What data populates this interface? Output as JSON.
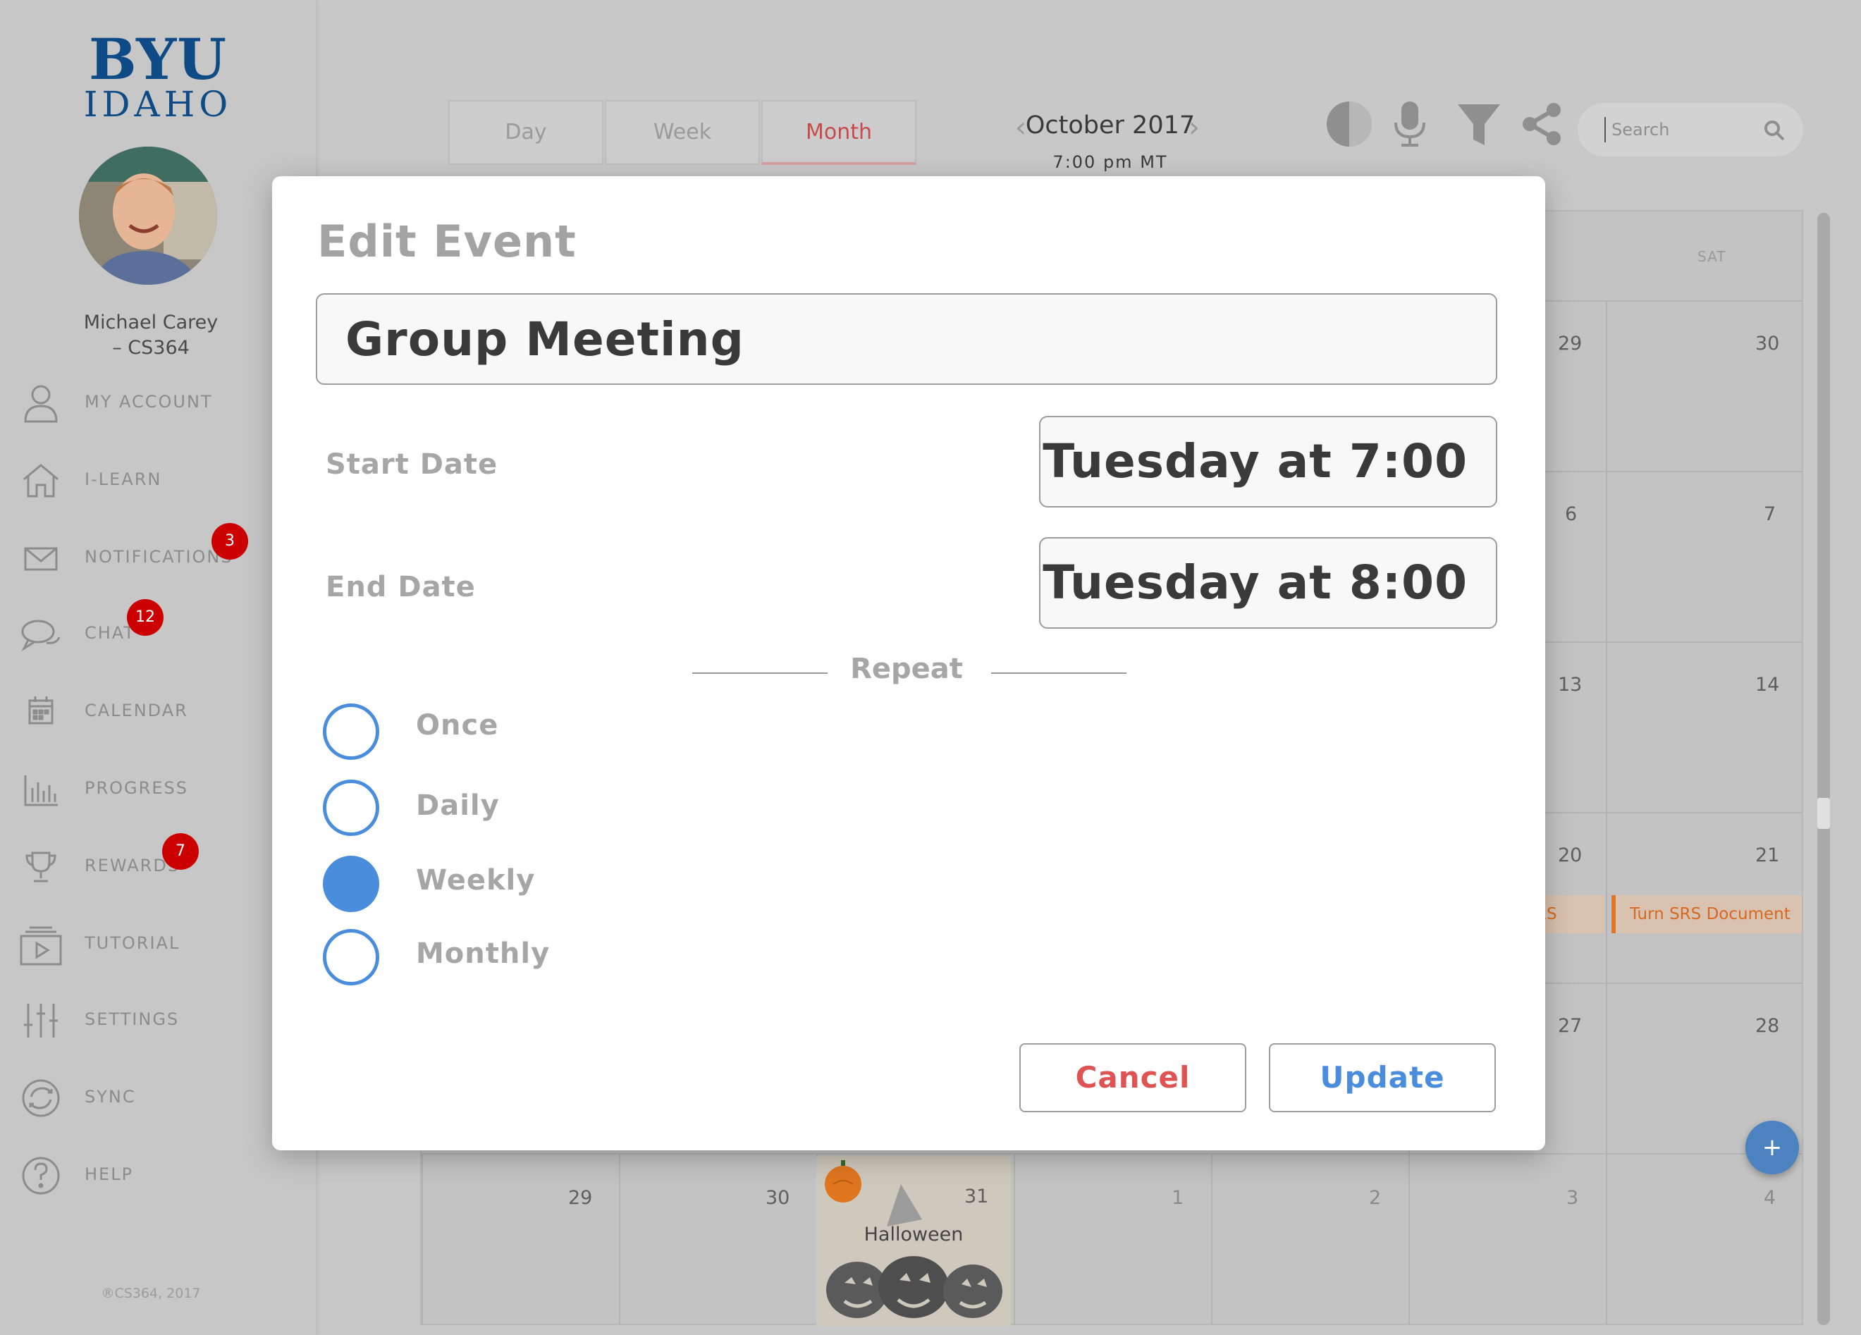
{
  "sidebar": {
    "logo_main": "BYU",
    "logo_sub": "IDAHO",
    "user_name_line1": "Michael Carey",
    "user_name_line2": "– CS364",
    "items": [
      {
        "label": "MY ACCOUNT",
        "icon": "person-icon"
      },
      {
        "label": "I-LEARN",
        "icon": "home-icon"
      },
      {
        "label": "NOTIFICATIONS",
        "icon": "mail-icon",
        "badge": "3"
      },
      {
        "label": "CHAT",
        "icon": "chat-icon",
        "badge": "12"
      },
      {
        "label": "CALENDAR",
        "icon": "calendar-icon"
      },
      {
        "label": "PROGRESS",
        "icon": "bar-chart-icon"
      },
      {
        "label": "REWARDS",
        "icon": "trophy-icon",
        "badge": "7"
      },
      {
        "label": "TUTORIAL",
        "icon": "video-icon"
      },
      {
        "label": "SETTINGS",
        "icon": "sliders-icon"
      },
      {
        "label": "SYNC",
        "icon": "sync-icon"
      },
      {
        "label": "HELP",
        "icon": "help-icon"
      }
    ],
    "copyright": "®CS364, 2017"
  },
  "toolbar": {
    "views": [
      "Day",
      "Week",
      "Month"
    ],
    "active_view": "Month",
    "month_title": "October 2017",
    "current_time": "7:00 pm MT",
    "search_placeholder": "Search"
  },
  "calendar": {
    "sat_label": "SAT",
    "fri_dates": [
      "29",
      "6",
      "13",
      "20",
      "27"
    ],
    "sat_dates": [
      "30",
      "7",
      "14",
      "21",
      "28"
    ],
    "last_row": [
      "29",
      "30",
      "31",
      "1",
      "2",
      "3",
      "4"
    ],
    "event_partial": "RS",
    "event_full": "Turn SRS Document",
    "holiday": "Halloween",
    "fab_label": "+"
  },
  "modal": {
    "title": "Edit Event",
    "event_name": "Group Meeting",
    "start_label": "Start Date",
    "start_value": "Tuesday at 7:00",
    "end_label": "End Date",
    "end_value": "Tuesday at 8:00",
    "repeat_label": "Repeat",
    "repeat_options": [
      "Once",
      "Daily",
      "Weekly",
      "Monthly"
    ],
    "repeat_selected": "Weekly",
    "cancel_label": "Cancel",
    "update_label": "Update"
  },
  "colors": {
    "brand_blue": "#0e4a86",
    "accent_blue": "#4a8ddc",
    "cancel_red": "#e05353",
    "badge_red": "#cc0000",
    "event_orange": "#e0762a"
  }
}
